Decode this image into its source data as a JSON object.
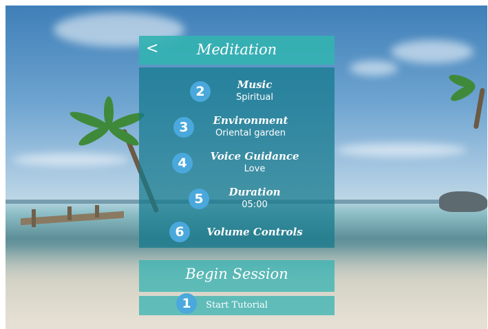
{
  "header": {
    "back_icon": "chevron-left-icon",
    "back_glyph": "<",
    "title": "Meditation"
  },
  "menu": [
    {
      "number": "2",
      "label": "Music",
      "value": "Spiritual"
    },
    {
      "number": "3",
      "label": "Environment",
      "value": "Oriental garden"
    },
    {
      "number": "4",
      "label": "Voice Guidance",
      "value": "Love"
    },
    {
      "number": "5",
      "label": "Duration",
      "value": "05:00"
    },
    {
      "number": "6",
      "label": "Volume Controls"
    }
  ],
  "begin": {
    "label": "Begin Session"
  },
  "tutorial": {
    "number": "1",
    "label": "Start Tutorial"
  },
  "colors": {
    "panel_teal": "#34b2b2",
    "list_teal": "#14788c",
    "badge_blue": "#4aa8dc",
    "text": "#ffffff"
  }
}
